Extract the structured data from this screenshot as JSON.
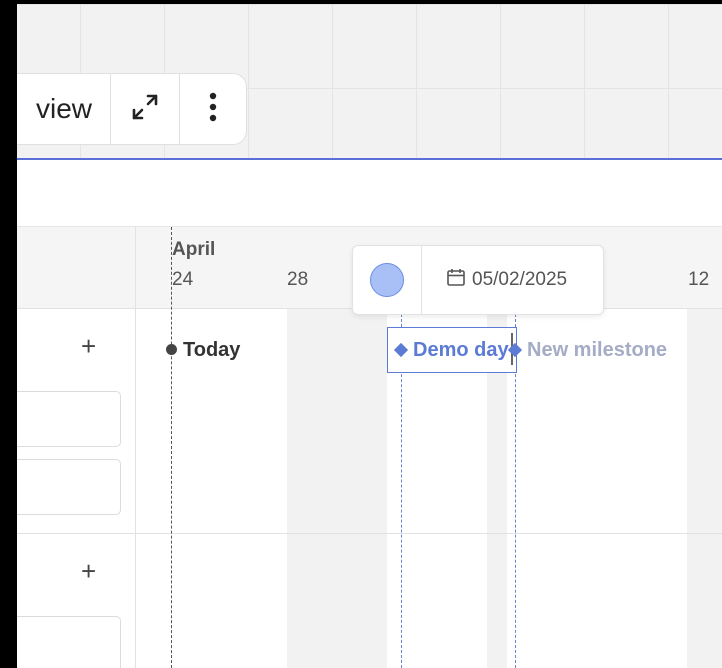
{
  "toolbar": {
    "view_label": "view",
    "expand_icon": "expand-arrows-icon",
    "more_icon": "vertical-ellipsis-icon"
  },
  "timeline": {
    "month": "April",
    "ticks": [
      "24",
      "28",
      "12"
    ]
  },
  "rows": {
    "add_symbol": "+"
  },
  "milestones": {
    "today": "Today",
    "demo_day": "Demo day",
    "new_milestone": "New milestone"
  },
  "popover": {
    "date": "05/02/2025",
    "color": "#a8c0f5",
    "calendar_icon": "calendar-icon"
  },
  "colors": {
    "accent": "#5b7bd5",
    "divider_blue": "#5b70d6"
  }
}
